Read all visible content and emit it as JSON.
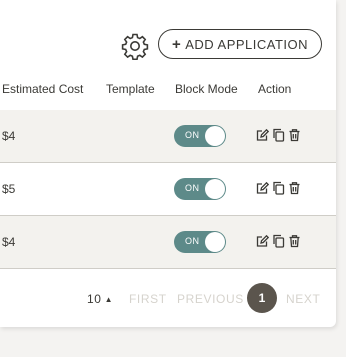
{
  "toolbar": {
    "settings_icon": "gear-icon",
    "add_button_icon": "plus-icon",
    "add_button_label": "ADD APPLICATION"
  },
  "table": {
    "columns": [
      "Estimated Cost",
      "Template",
      "Block Mode",
      "Action"
    ],
    "rows": [
      {
        "estimated_cost": "$4",
        "template": "",
        "block_mode": "ON"
      },
      {
        "estimated_cost": "$5",
        "template": "",
        "block_mode": "ON"
      },
      {
        "estimated_cost": "$4",
        "template": "",
        "block_mode": "ON"
      }
    ],
    "action_icons": [
      "edit-icon",
      "copy-icon",
      "delete-icon"
    ]
  },
  "pagination": {
    "page_size": "10",
    "first_label": "FIRST",
    "previous_label": "PREVIOUS",
    "current_page": "1",
    "next_label": "NEXT"
  },
  "colors": {
    "toggle_on": "#5d8a89",
    "current_page_bg": "#5b554d",
    "disabled_text": "#d6d3cd",
    "row_alt_bg": "#f3f2ee"
  }
}
